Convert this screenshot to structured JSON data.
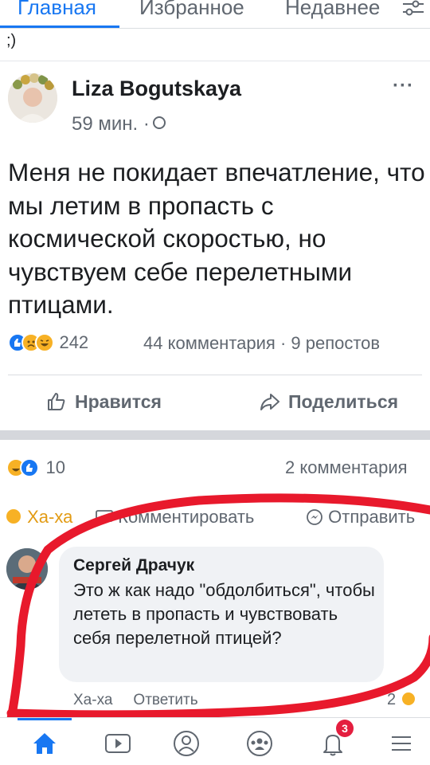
{
  "top_tabs": {
    "home": "Главная",
    "favorites": "Избранное",
    "recent": "Недавнее"
  },
  "status_text": ";)",
  "post": {
    "author": "Liza Bogutskaya",
    "time": "59 мин. ·",
    "text": "Меня не покидает впечатление, что мы летим в пропасть с космической скоростью, но чувствуем себе перелетными птицами.",
    "reactions_count": "242",
    "stats": "44 комментария · 9 репостов",
    "like_label": "Нравится",
    "share_label": "Поделиться"
  },
  "second_item": {
    "reactions_count": "10",
    "comments_count": "2 комментария",
    "haha_label": "Ха-ха",
    "comment_label": "Комментировать",
    "send_label": "Отправить"
  },
  "comment": {
    "author": "Сергей Драчук",
    "text": "Это ж как надо \"обдолбиться\", чтобы лететь в пропасть и чувствовать себя перелетной птицей?",
    "haha_label": "Ха-ха",
    "reply_label": "Ответить",
    "reactions_count": "2"
  },
  "bottom_nav": {
    "notifications_badge": "3"
  },
  "colors": {
    "accent": "#1877f2",
    "annotation": "#e8192c",
    "haha": "#f7b125"
  }
}
